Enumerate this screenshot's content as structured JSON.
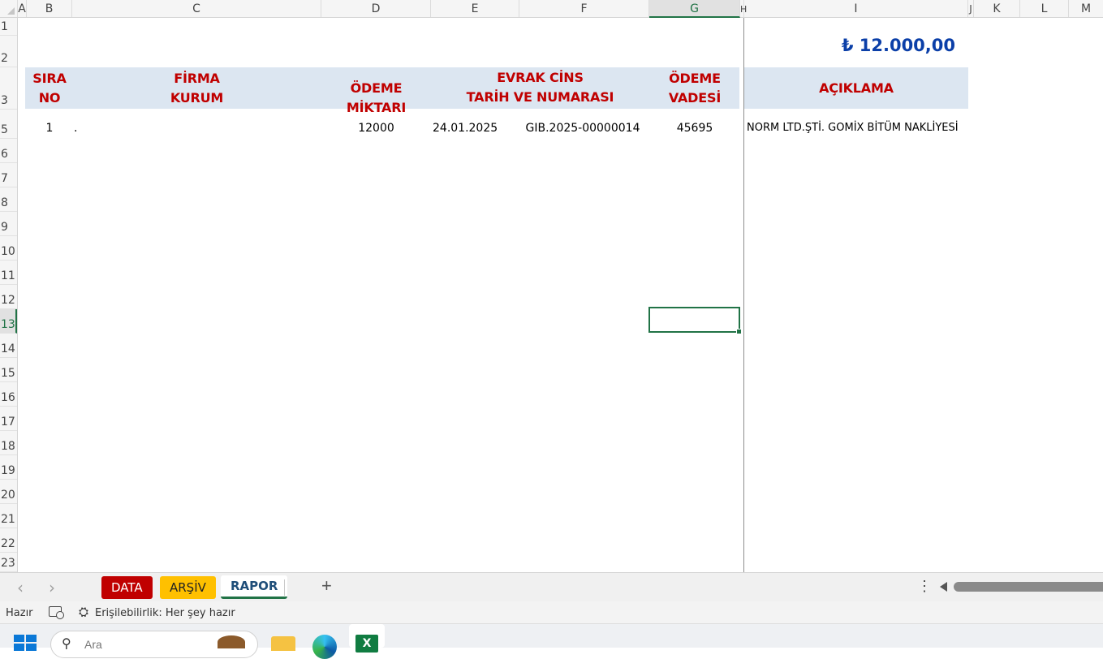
{
  "columns": [
    "A",
    "B",
    "C",
    "D",
    "E",
    "F",
    "G",
    "H",
    "I",
    "J",
    "K",
    "L",
    "M"
  ],
  "rows": [
    "1",
    "2",
    "3",
    "5",
    "6",
    "7",
    "8",
    "9",
    "10",
    "11",
    "12",
    "13",
    "14",
    "15",
    "16",
    "17",
    "18",
    "19",
    "20",
    "21",
    "22",
    "23"
  ],
  "selected_column": "G",
  "selected_row": "13",
  "total": "₺ 12.000,00",
  "headers": {
    "sira_no": "SIRA\nNO",
    "firma_kurum": "FİRMA\nKURUM",
    "odeme_miktari": "ÖDEME MİKTARI",
    "evrak": "EVRAK CİNS\nTARİH VE NUMARASI",
    "odeme_vadesi": "ÖDEME\nVADESİ",
    "aciklama": "AÇIKLAMA"
  },
  "record": {
    "sira": "1",
    "firma": ".",
    "miktar": "12000",
    "tarih": "24.01.2025",
    "evrak_no": "GIB.2025-00000014",
    "vade": "45695",
    "aciklama": "NORM LTD.ŞTİ.  GOMİX BİTÜM NAKLİYESİ"
  },
  "sheet_tabs": {
    "data": "DATA",
    "arsiv": "ARŞİV",
    "rapor": "RAPOR"
  },
  "tab_colors": {
    "data": "#c00000",
    "arsiv": "#ffc000"
  },
  "status": {
    "ready": "Hazır",
    "accessibility": "Erişilebilirlik: Her şey hazır"
  },
  "taskbar": {
    "search_placeholder": "Ara"
  }
}
